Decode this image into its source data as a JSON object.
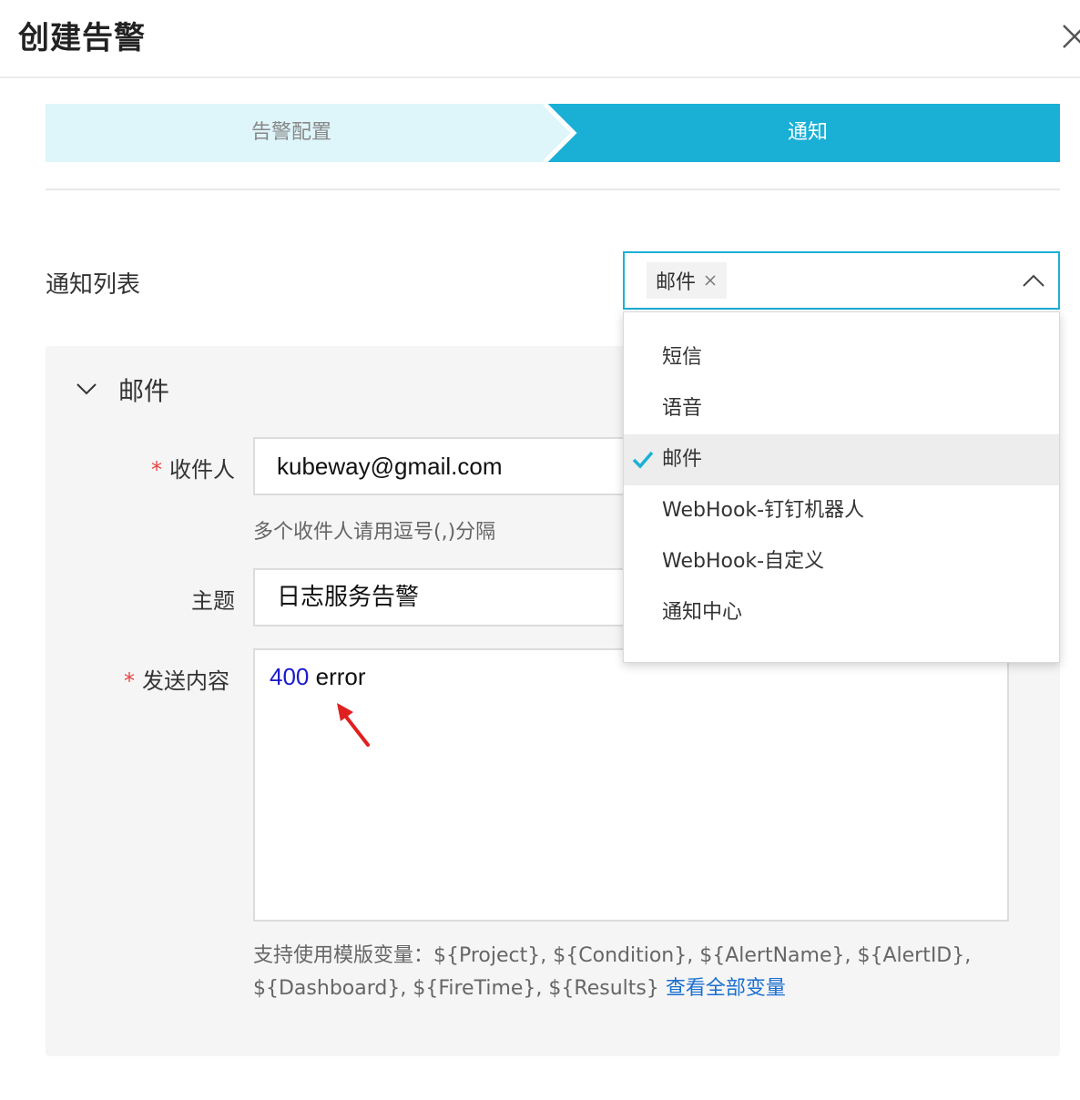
{
  "dialog": {
    "title": "创建告警"
  },
  "steps": [
    {
      "label": "告警配置"
    },
    {
      "label": "通知"
    }
  ],
  "notify": {
    "label": "通知列表",
    "selected_tag": "邮件",
    "options": [
      {
        "label": "短信"
      },
      {
        "label": "语音"
      },
      {
        "label": "邮件"
      },
      {
        "label": "WebHook-钉钉机器人"
      },
      {
        "label": "WebHook-自定义"
      },
      {
        "label": "通知中心"
      }
    ]
  },
  "email_panel": {
    "title": "邮件",
    "recipient": {
      "label": "收件人",
      "value": "kubeway@gmail.com",
      "hint": "多个收件人请用逗号(,)分隔"
    },
    "subject": {
      "label": "主题",
      "value": "日志服务告警"
    },
    "content": {
      "label": "发送内容",
      "value_number": "400",
      "value_text": " error"
    },
    "variables": {
      "text_line1": "支持使用模版变量：${Project}, ${Condition}, ${AlertName}, ${AlertID},",
      "text_line2": "${Dashboard}, ${FireTime}, ${Results} ",
      "link": "查看全部变量"
    }
  },
  "colors": {
    "accent": "#1ab0d6",
    "step_inactive_bg": "#def5fa",
    "required": "#e64545",
    "link": "#1a6fd1",
    "annotation_arrow": "#e02020"
  }
}
